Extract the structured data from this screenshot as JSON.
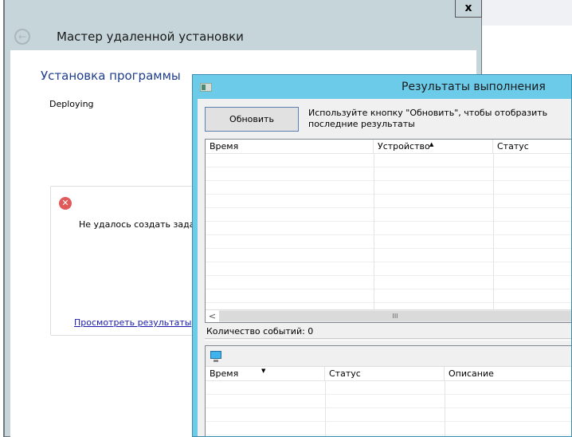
{
  "wizard": {
    "title": "Мастер удаленной установки",
    "heading": "Установка программы",
    "status": "Deploying",
    "error_message": "Не удалось создать задачу.",
    "view_results_link": "Просмотреть результаты",
    "close_label": "x"
  },
  "results": {
    "title": "Результаты выполнения",
    "refresh_button": "Обновить",
    "hint": "Используйте кнопку \"Обновить\", чтобы отобразить последние результаты",
    "events_columns": [
      "Время",
      "Устройство",
      "Статус"
    ],
    "events_count": "Количество событий: 0",
    "details_columns": [
      "Время",
      "Статус",
      "Описание"
    ],
    "scroll_left": "<",
    "scroll_thumb": "III"
  }
}
